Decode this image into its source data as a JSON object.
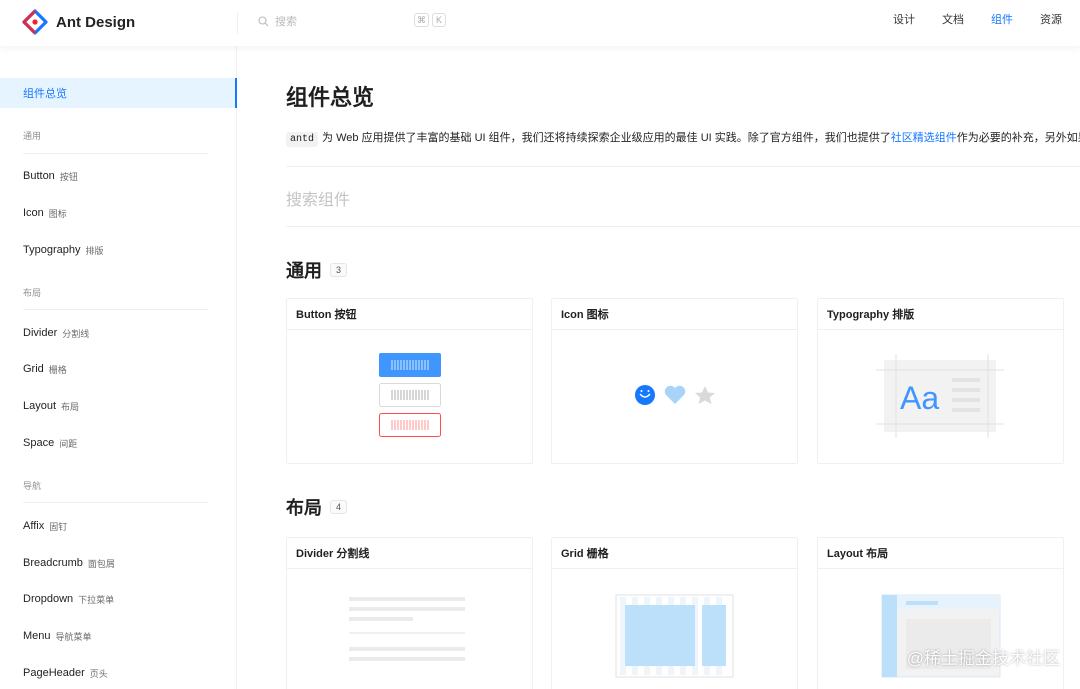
{
  "header": {
    "logo_text": "Ant Design",
    "search_placeholder": "搜索",
    "kbd_cmd": "⌘",
    "kbd_k": "K",
    "nav": [
      "设计",
      "文档",
      "组件",
      "资源"
    ],
    "active_nav": "组件"
  },
  "sidebar": {
    "overview": "组件总览",
    "groups": [
      {
        "title": "通用",
        "items": [
          {
            "en": "Button",
            "zh": "按钮"
          },
          {
            "en": "Icon",
            "zh": "图标"
          },
          {
            "en": "Typography",
            "zh": "排版"
          }
        ]
      },
      {
        "title": "布局",
        "items": [
          {
            "en": "Divider",
            "zh": "分割线"
          },
          {
            "en": "Grid",
            "zh": "栅格"
          },
          {
            "en": "Layout",
            "zh": "布局"
          },
          {
            "en": "Space",
            "zh": "间距"
          }
        ]
      },
      {
        "title": "导航",
        "items": [
          {
            "en": "Affix",
            "zh": "固钉"
          },
          {
            "en": "Breadcrumb",
            "zh": "面包屑"
          },
          {
            "en": "Dropdown",
            "zh": "下拉菜单"
          },
          {
            "en": "Menu",
            "zh": "导航菜单"
          },
          {
            "en": "PageHeader",
            "zh": "页头"
          }
        ]
      }
    ]
  },
  "main": {
    "title": "组件总览",
    "intro_code": "antd",
    "intro_text_1": "为 Web 应用提供了丰富的基础 UI 组件，我们还将持续探索企业级应用的最佳 UI 实践。除了官方组件，我们也提供了",
    "intro_link": "社区精选组件",
    "intro_text_2": "作为必要的补充，另外如果您还",
    "search_placeholder": "搜索组件",
    "sections": [
      {
        "title": "通用",
        "count": "3",
        "cards": [
          "Button 按钮",
          "Icon 图标",
          "Typography 排版"
        ]
      },
      {
        "title": "布局",
        "count": "4",
        "cards": [
          "Divider 分割线",
          "Grid 栅格",
          "Layout 布局"
        ]
      }
    ],
    "typography_sample": "Aa"
  },
  "colors": {
    "accent": "#1677ff",
    "active_bg": "#e6f4ff",
    "danger": "#ff4d4f",
    "light_blue": "#bde0fa"
  },
  "watermark": "@稀土掘金技术社区"
}
